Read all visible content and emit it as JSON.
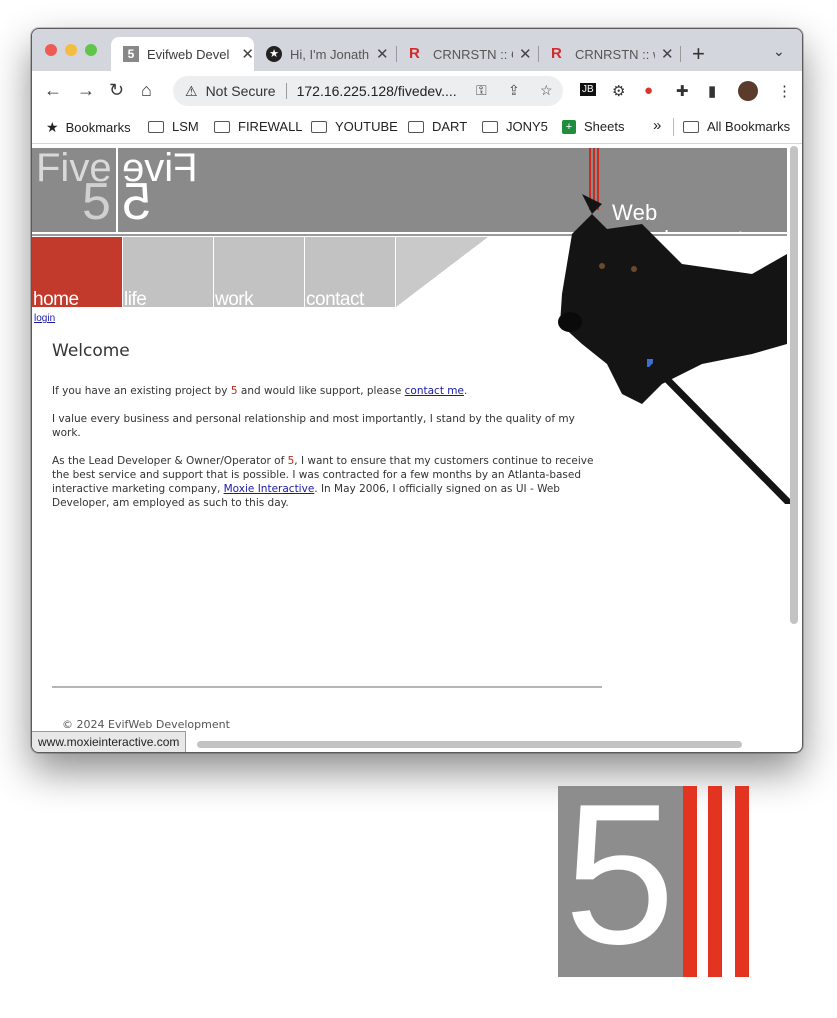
{
  "browser": {
    "tabs": [
      {
        "label": "Evifweb Devel",
        "icon": "five-logo-icon",
        "active": true
      },
      {
        "label": "Hi, I'm Jonath",
        "icon": "star-badge-icon",
        "active": false
      },
      {
        "label": "CRNRSTN :: C",
        "icon": "r-logo-icon",
        "active": false
      },
      {
        "label": "CRNRSTN :: w",
        "icon": "r-logo-icon",
        "active": false
      }
    ],
    "close_glyph": "✕",
    "new_tab_glyph": "+",
    "tab_menu_glyph": "⌄",
    "security_label": "Not Secure",
    "url": "172.16.225.128/fivedev....",
    "bookmarks": [
      {
        "label": "Bookmarks",
        "icon": "star-icon"
      },
      {
        "label": "LSM",
        "icon": "folder-icon"
      },
      {
        "label": "FIREWALL",
        "icon": "folder-icon"
      },
      {
        "label": "YOUTUBE",
        "icon": "folder-icon"
      },
      {
        "label": "DART",
        "icon": "folder-icon"
      },
      {
        "label": "JONY5",
        "icon": "folder-icon"
      },
      {
        "label": "Sheets",
        "icon": "sheets-icon"
      }
    ],
    "overflow_glyph": "»",
    "all_bookmarks": "All Bookmarks",
    "status_url": "www.moxieinteractive.com"
  },
  "site": {
    "logo_word": "Five",
    "logo_number": "5",
    "tagline": "Web Development",
    "nav": [
      "home",
      "life",
      "work",
      "contact"
    ],
    "login": "login",
    "heading": "Welcome",
    "p1_before": "If you have an existing project by ",
    "p1_five": "5",
    "p1_middle": " and would like support, please ",
    "p1_link": "contact me",
    "p1_after": ".",
    "p2": "I value every business and personal relationship and most importantly, I stand by the quality of my work.",
    "p3_before": "As the Lead Developer & Owner/Operator of ",
    "p3_five": "5",
    "p3_middle": ", I want to ensure that my customers continue to receive the best service and support that is possible. I was contracted for a few months by an Atlanta-based interactive marketing company, ",
    "p3_link": "Moxie Interactive",
    "p3_after": ". In May 2006, I officially signed on as UI - Web Developer, am employed as such to this day.",
    "footer": "© 2024 EvifWeb Development"
  },
  "big_logo": {
    "number": "5"
  },
  "colors": {
    "brand_red": "#e23420",
    "brand_gray": "#8d8d8d",
    "link": "#1a1aa8"
  }
}
